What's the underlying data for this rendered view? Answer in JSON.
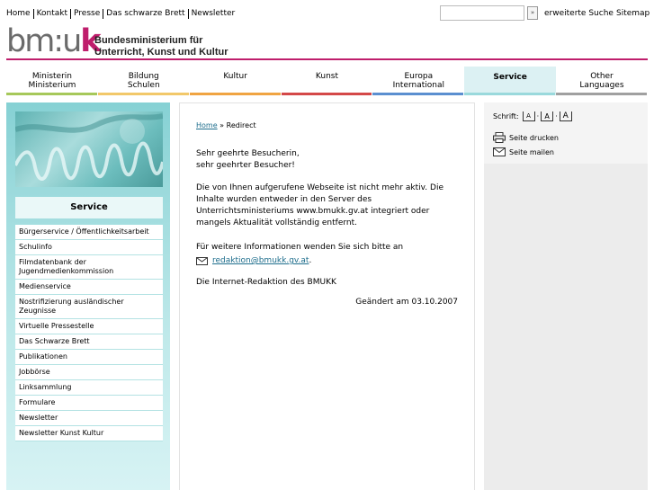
{
  "topnav": {
    "items": [
      "Home",
      "Kontakt",
      "Presse",
      "Das schwarze Brett",
      "Newsletter"
    ],
    "search_button": "»",
    "advanced_search": "erweiterte Suche",
    "sitemap": "Sitemap"
  },
  "logo": {
    "mark_main": "bm:u",
    "mark_accent": "k",
    "line1": "Bundesministerium für",
    "line2": "Unterricht, Kunst und Kultur"
  },
  "mainnav": [
    {
      "line1": "Ministerin",
      "line2": "Ministerium",
      "color": "#a6c85a"
    },
    {
      "line1": "Bildung",
      "line2": "Schulen",
      "color": "#f2c86a"
    },
    {
      "line1": "Kultur",
      "line2": "",
      "color": "#f0a442"
    },
    {
      "line1": "Kunst",
      "line2": "",
      "color": "#d44848"
    },
    {
      "line1": "Europa",
      "line2": "International",
      "color": "#5b8fd0"
    },
    {
      "line1": "Service",
      "line2": "",
      "color": "#9ad9dc",
      "active": true
    },
    {
      "line1": "Other",
      "line2": "Languages",
      "color": "#a0a0a0"
    }
  ],
  "sidebar": {
    "heading": "Service",
    "items": [
      "Bürgerservice / Öffentlichkeitsarbeit",
      "Schulinfo",
      "Filmdatenbank der Jugendmedienkommission",
      "Medienservice",
      "Nostrifizierung ausländischer Zeugnisse",
      "Virtuelle Pressestelle",
      "Das Schwarze Brett",
      "Publikationen",
      "Jobbörse",
      "Linksammlung",
      "Formulare",
      "Newsletter",
      "Newsletter Kunst Kultur"
    ]
  },
  "content": {
    "breadcrumb_home": "Home",
    "breadcrumb_sep": "»",
    "breadcrumb_current": "Redirect",
    "greeting_1": "Sehr geehrte Besucherin,",
    "greeting_2": "sehr geehrter Besucher!",
    "main_text": "Die von Ihnen aufgerufene Webseite ist nicht mehr aktiv. Die Inhalte wurden entweder in den Server des Unterrichtsministeriums www.bmukk.gv.at integriert oder mangels Aktualität vollständig entfernt.",
    "info_text": "Für weitere Informationen wenden Sie sich bitte an",
    "email": "redaktion@bmukk.gv.at",
    "email_suffix": ".",
    "signature": "Die Internet-Redaktion des BMUKK",
    "changed": "Geändert am 03.10.2007"
  },
  "rightcol": {
    "font_label": "Schrift:",
    "font_glyph": "A",
    "font_sep": "·",
    "print": "Seite drucken",
    "mail": "Seite mailen"
  },
  "colors": {
    "brand": "#bf1e6c",
    "service_teal": "#86d1d4",
    "link": "#1d6d8c"
  }
}
